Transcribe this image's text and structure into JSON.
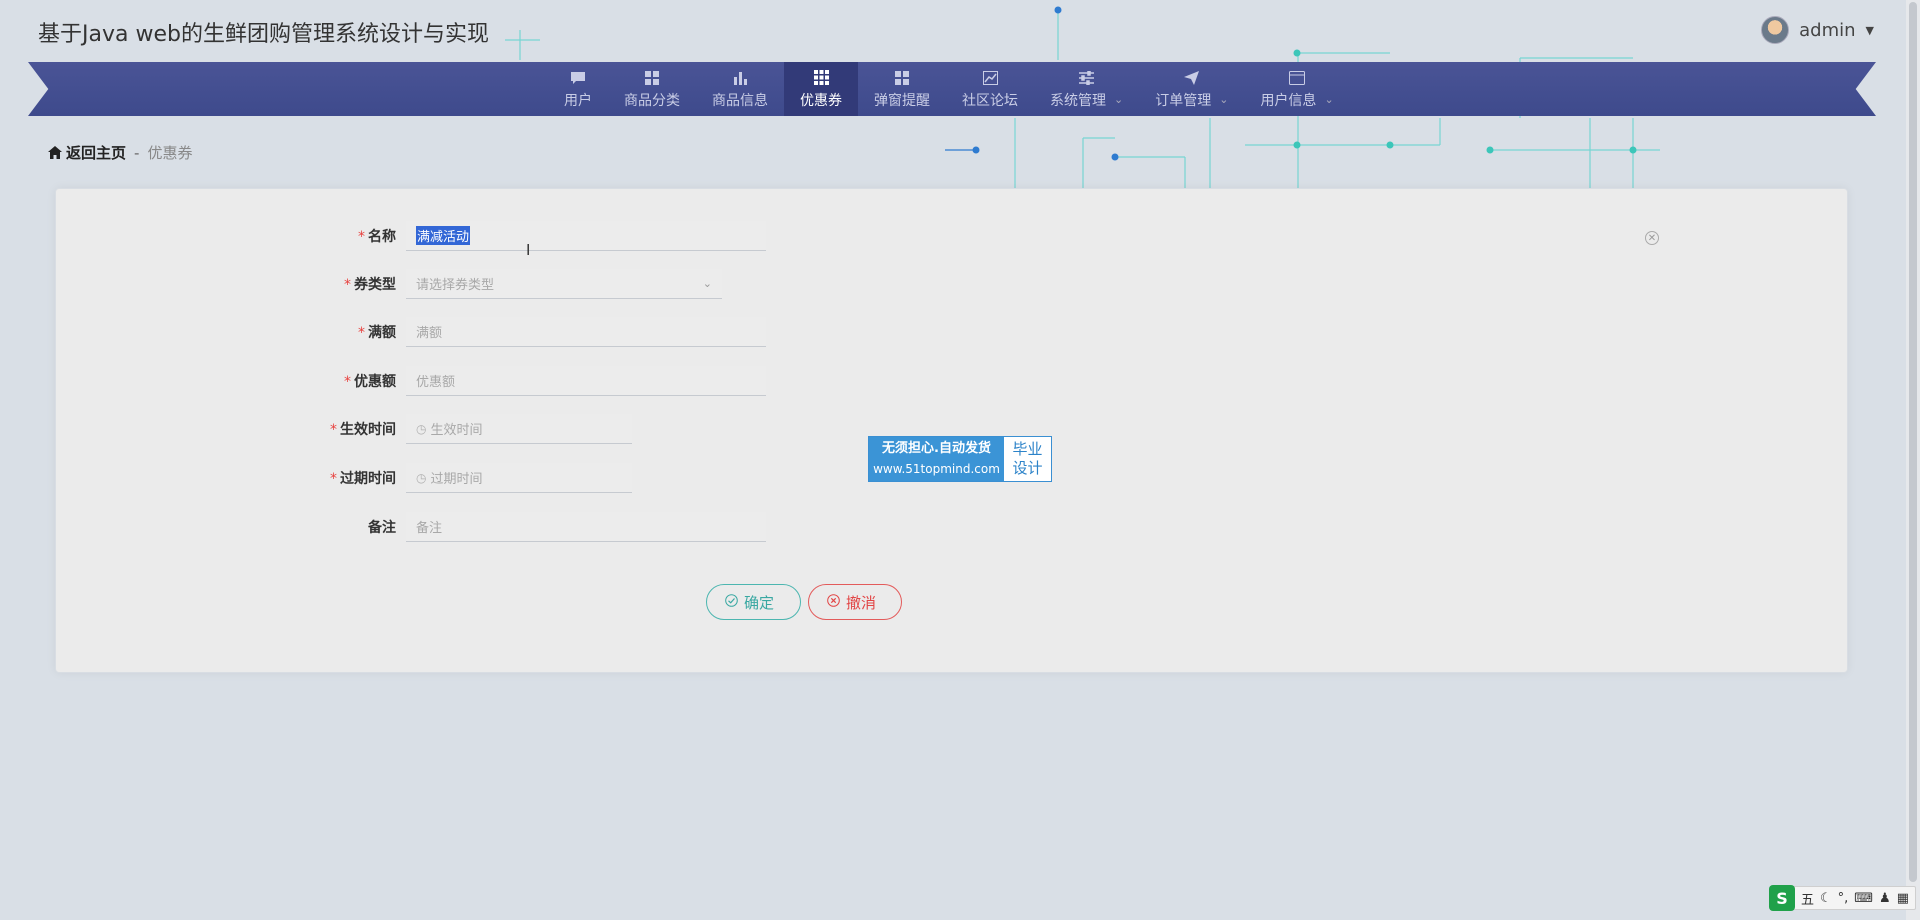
{
  "app": {
    "title": "基于Java web的生鲜团购管理系统设计与实现"
  },
  "user": {
    "name": "admin"
  },
  "nav": {
    "items": [
      {
        "label": "用户",
        "icon": "chat-icon",
        "active": false,
        "dropdown": false
      },
      {
        "label": "商品分类",
        "icon": "grid-icon",
        "active": false,
        "dropdown": false
      },
      {
        "label": "商品信息",
        "icon": "bar-chart-icon",
        "active": false,
        "dropdown": false
      },
      {
        "label": "优惠券",
        "icon": "apps-icon",
        "active": true,
        "dropdown": false
      },
      {
        "label": "弹窗提醒",
        "icon": "grid-icon",
        "active": false,
        "dropdown": false
      },
      {
        "label": "社区论坛",
        "icon": "line-chart-icon",
        "active": false,
        "dropdown": false
      },
      {
        "label": "系统管理",
        "icon": "sliders-icon",
        "active": false,
        "dropdown": true
      },
      {
        "label": "订单管理",
        "icon": "send-icon",
        "active": false,
        "dropdown": true
      },
      {
        "label": "用户信息",
        "icon": "card-icon",
        "active": false,
        "dropdown": true
      }
    ]
  },
  "breadcrumb": {
    "home": "返回主页",
    "separator": "-",
    "current": "优惠券"
  },
  "form": {
    "name": {
      "label": "名称",
      "value": "满减活动",
      "required": true
    },
    "coupon_type": {
      "label": "券类型",
      "placeholder": "请选择券类型",
      "required": true
    },
    "threshold": {
      "label": "满额",
      "placeholder": "满额",
      "required": true
    },
    "discount": {
      "label": "优惠额",
      "placeholder": "优惠额",
      "required": true
    },
    "start_time": {
      "label": "生效时间",
      "placeholder": "生效时间",
      "required": true
    },
    "expire_time": {
      "label": "过期时间",
      "placeholder": "过期时间",
      "required": true
    },
    "remark": {
      "label": "备注",
      "placeholder": "备注",
      "required": false
    },
    "required_mark": "*",
    "submit_label": "确定",
    "cancel_label": "撤消"
  },
  "watermark": {
    "line1": "无须担心.自动发货",
    "url": "www.51topmind.com",
    "right1": "毕业",
    "right2": "设计"
  },
  "tray": {
    "ime": "五",
    "punct": "°,",
    "logo": "S"
  },
  "colors": {
    "nav_bg": "#4a5496",
    "nav_active": "#323a78",
    "ok": "#39a8a2",
    "cancel": "#e24545",
    "required": "#e8423f"
  }
}
